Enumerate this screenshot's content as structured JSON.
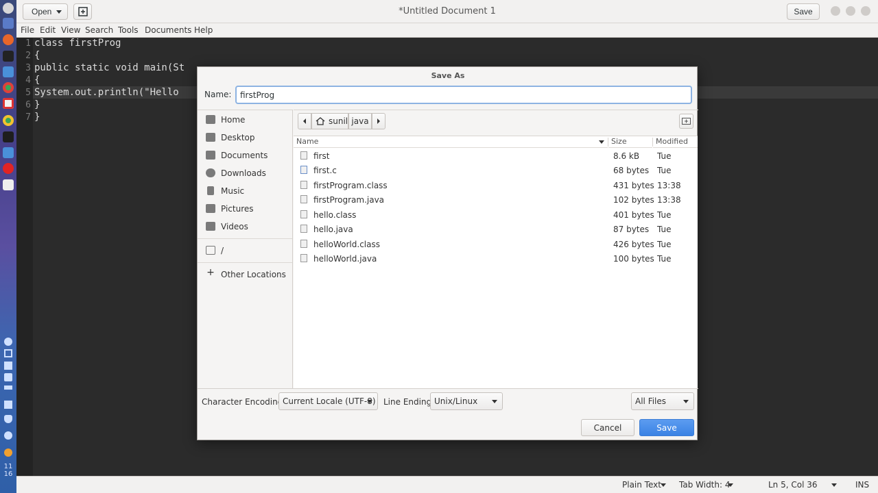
{
  "header": {
    "open_label": "Open",
    "window_title": "*Untitled Document 1",
    "save_label": "Save"
  },
  "menu": [
    "File",
    "Edit",
    "View",
    "Search",
    "Tools",
    "Documents",
    "Help"
  ],
  "editor": {
    "line_numbers": [
      "1",
      "2",
      "3",
      "4",
      "5",
      "6",
      "7"
    ],
    "lines": [
      "class firstProg",
      "{",
      "public static void main(St",
      "{",
      "System.out.println(\"Hello",
      "}",
      "}"
    ]
  },
  "dialog": {
    "title": "Save As",
    "name_label": "Name:",
    "name_value": "firstProg",
    "sidebar": [
      "Home",
      "Desktop",
      "Documents",
      "Downloads",
      "Music",
      "Pictures",
      "Videos"
    ],
    "sidebar_root": "/",
    "other_locations": "Other Locations",
    "path": [
      "sunil",
      "java"
    ],
    "columns": {
      "name": "Name",
      "size": "Size",
      "modified": "Modified"
    },
    "files": [
      {
        "name": "first",
        "size": "8.6 kB",
        "modified": "Tue"
      },
      {
        "name": "first.c",
        "size": "68 bytes",
        "modified": "Tue"
      },
      {
        "name": "firstProgram.class",
        "size": "431 bytes",
        "modified": "13:38"
      },
      {
        "name": "firstProgram.java",
        "size": "102 bytes",
        "modified": "13:38"
      },
      {
        "name": "hello.class",
        "size": "401 bytes",
        "modified": "Tue"
      },
      {
        "name": "hello.java",
        "size": "87 bytes",
        "modified": "Tue"
      },
      {
        "name": "helloWorld.class",
        "size": "426 bytes",
        "modified": "Tue"
      },
      {
        "name": "helloWorld.java",
        "size": "100 bytes",
        "modified": "Tue"
      }
    ],
    "encoding_label": "Character Encoding:",
    "encoding_value": "Current Locale (UTF-8)",
    "line_ending_label": "Line Ending:",
    "line_ending_value": "Unix/Linux",
    "filter_value": "All Files",
    "cancel_label": "Cancel",
    "save_label": "Save"
  },
  "status": {
    "syntax": "Plain Text",
    "tab_width": "Tab Width: 4",
    "position": "Ln 5, Col 36",
    "mode": "INS"
  },
  "dock": {
    "clock_line1": "11",
    "clock_line2": "16"
  }
}
